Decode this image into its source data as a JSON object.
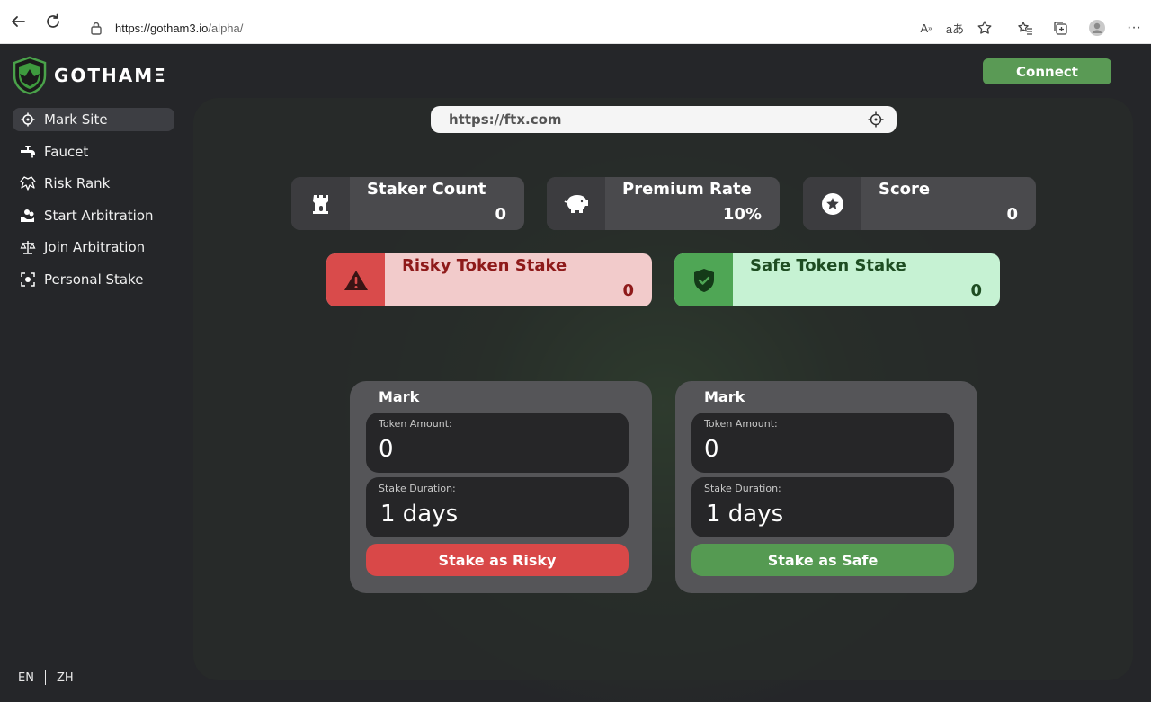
{
  "browser": {
    "url_host": "https://gotham3.io",
    "url_path": "/alpha/"
  },
  "app": {
    "logo_text": "GOTHAMΞ",
    "connect_label": "Connect"
  },
  "sidebar": {
    "items": [
      {
        "label": "Mark Site",
        "icon": "crosshair-icon",
        "active": true
      },
      {
        "label": "Faucet",
        "icon": "faucet-icon",
        "active": false
      },
      {
        "label": "Risk Rank",
        "icon": "dragon-icon",
        "active": false
      },
      {
        "label": "Start Arbitration",
        "icon": "hand-coins-icon",
        "active": false
      },
      {
        "label": "Join Arbitration",
        "icon": "scales-icon",
        "active": false
      },
      {
        "label": "Personal Stake",
        "icon": "focus-user-icon",
        "active": false
      }
    ],
    "languages": [
      "EN",
      "ZH"
    ]
  },
  "site_input": {
    "value": "https://ftx.com"
  },
  "stats": [
    {
      "title": "Staker Count",
      "value": "0",
      "icon": "tower-icon"
    },
    {
      "title": "Premium Rate",
      "value": "10%",
      "icon": "piggy-bank-icon"
    },
    {
      "title": "Score",
      "value": "0",
      "icon": "star-circle-icon"
    }
  ],
  "stakes": {
    "risky": {
      "title": "Risky Token Stake",
      "value": "0",
      "icon": "warning-icon",
      "color": "#d94b4b"
    },
    "safe": {
      "title": "Safe Token Stake",
      "value": "0",
      "icon": "shield-check-icon",
      "color": "#4fa655"
    }
  },
  "forms": [
    {
      "title": "Mark",
      "amount_label": "Token Amount:",
      "amount_value": "0",
      "duration_label": "Stake Duration:",
      "duration_value": "1 days",
      "button_label": "Stake as Risky",
      "button_color": "#d94848"
    },
    {
      "title": "Mark",
      "amount_label": "Token Amount:",
      "amount_value": "0",
      "duration_label": "Stake Duration:",
      "duration_value": "1 days",
      "button_label": "Stake as Safe",
      "button_color": "#559a52"
    }
  ]
}
